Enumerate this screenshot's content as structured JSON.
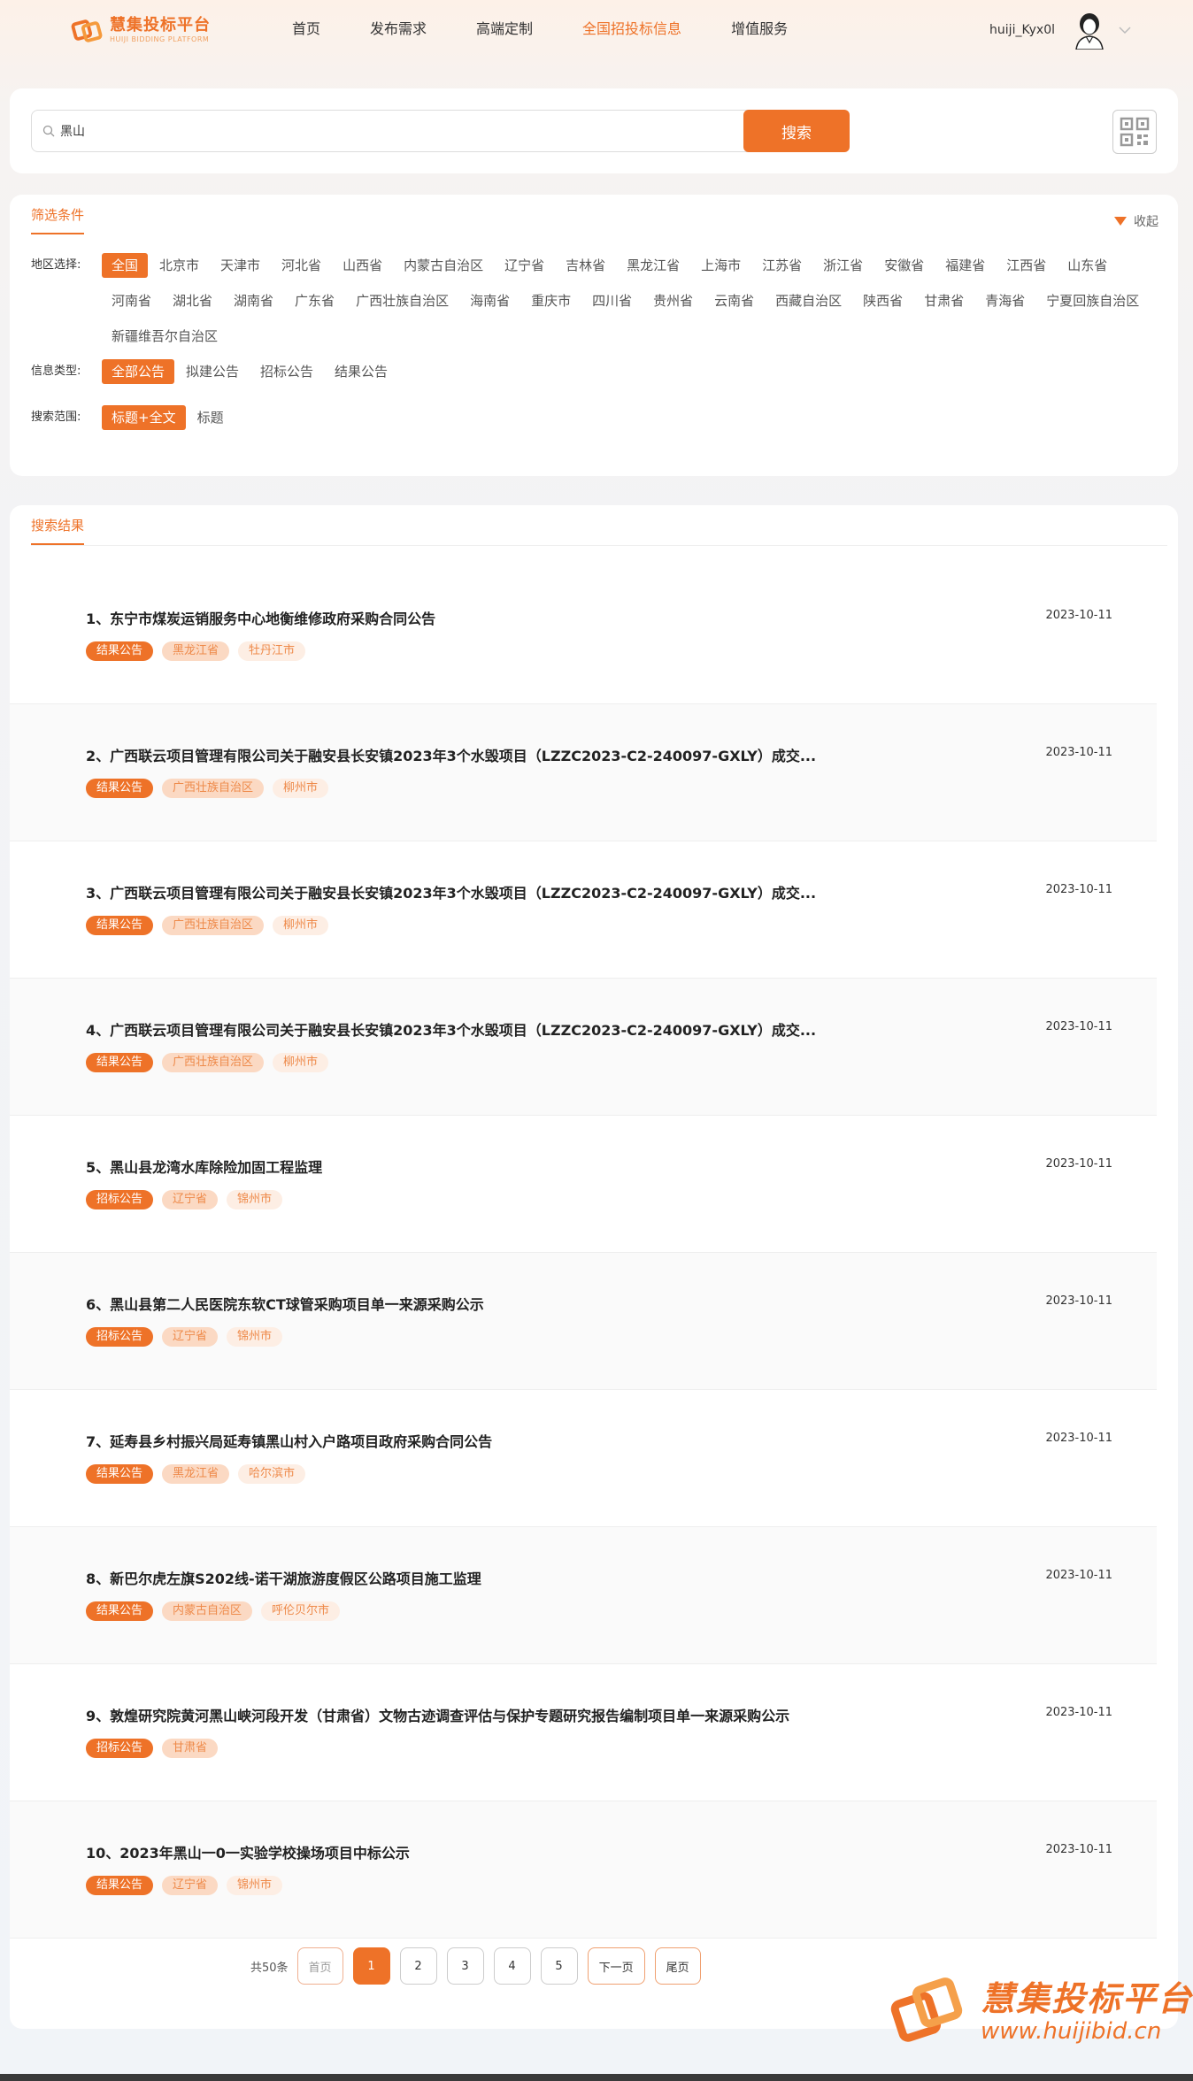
{
  "brand": {
    "name_cn": "慧集投标平台",
    "name_en": "HUIJI BIDDING PLATFORM"
  },
  "nav": [
    {
      "label": "首页",
      "active": false
    },
    {
      "label": "发布需求",
      "active": false
    },
    {
      "label": "高端定制",
      "active": false
    },
    {
      "label": "全国招投标信息",
      "active": true
    },
    {
      "label": "增值服务",
      "active": false
    }
  ],
  "user": {
    "name": "huiji_Kyx0l"
  },
  "search": {
    "value": "黑山",
    "button": "搜索"
  },
  "filters": {
    "title": "筛选条件",
    "collapse": "收起",
    "region": {
      "label": "地区选择:",
      "options": [
        "全国",
        "北京市",
        "天津市",
        "河北省",
        "山西省",
        "内蒙古自治区",
        "辽宁省",
        "吉林省",
        "黑龙江省",
        "上海市",
        "江苏省",
        "浙江省",
        "安徽省",
        "福建省",
        "江西省",
        "山东省",
        "河南省",
        "湖北省",
        "湖南省",
        "广东省",
        "广西壮族自治区",
        "海南省",
        "重庆市",
        "四川省",
        "贵州省",
        "云南省",
        "西藏自治区",
        "陕西省",
        "甘肃省",
        "青海省",
        "宁夏回族自治区",
        "新疆维吾尔自治区"
      ],
      "selected": "全国"
    },
    "info_type": {
      "label": "信息类型:",
      "options": [
        "全部公告",
        "拟建公告",
        "招标公告",
        "结果公告"
      ],
      "selected": "全部公告"
    },
    "scope": {
      "label": "搜索范围:",
      "options": [
        "标题+全文",
        "标题"
      ],
      "selected": "标题+全文"
    }
  },
  "results": {
    "title": "搜索结果",
    "items": [
      {
        "title": "1、东宁市煤炭运销服务中心地衡维修政府采购合同公告",
        "date": "2023-10-11",
        "type": "结果公告",
        "province": "黑龙江省",
        "city": "牡丹江市"
      },
      {
        "title": "2、广西联云项目管理有限公司关于融安县长安镇2023年3个水毁项目（LZZC2023-C2-240097-GXLY）成交...",
        "date": "2023-10-11",
        "type": "结果公告",
        "province": "广西壮族自治区",
        "city": "柳州市"
      },
      {
        "title": "3、广西联云项目管理有限公司关于融安县长安镇2023年3个水毁项目（LZZC2023-C2-240097-GXLY）成交...",
        "date": "2023-10-11",
        "type": "结果公告",
        "province": "广西壮族自治区",
        "city": "柳州市"
      },
      {
        "title": "4、广西联云项目管理有限公司关于融安县长安镇2023年3个水毁项目（LZZC2023-C2-240097-GXLY）成交...",
        "date": "2023-10-11",
        "type": "结果公告",
        "province": "广西壮族自治区",
        "city": "柳州市"
      },
      {
        "title": "5、黑山县龙湾水库除险加固工程监理",
        "date": "2023-10-11",
        "type": "招标公告",
        "province": "辽宁省",
        "city": "锦州市"
      },
      {
        "title": "6、黑山县第二人民医院东软CT球管采购项目单一来源采购公示",
        "date": "2023-10-11",
        "type": "招标公告",
        "province": "辽宁省",
        "city": "锦州市"
      },
      {
        "title": "7、延寿县乡村振兴局延寿镇黑山村入户路项目政府采购合同公告",
        "date": "2023-10-11",
        "type": "结果公告",
        "province": "黑龙江省",
        "city": "哈尔滨市"
      },
      {
        "title": "8、新巴尔虎左旗S202线-诺干湖旅游度假区公路项目施工监理",
        "date": "2023-10-11",
        "type": "结果公告",
        "province": "内蒙古自治区",
        "city": "呼伦贝尔市"
      },
      {
        "title": "9、敦煌研究院黄河黑山峡河段开发（甘肃省）文物古迹调查评估与保护专题研究报告编制项目单一来源采购公示",
        "date": "2023-10-11",
        "type": "招标公告",
        "province": "甘肃省",
        "city": ""
      },
      {
        "title": "10、2023年黑山一0一实验学校操场项目中标公示",
        "date": "2023-10-11",
        "type": "结果公告",
        "province": "辽宁省",
        "city": "锦州市"
      }
    ]
  },
  "pagination": {
    "total": "共50条",
    "first": "首页",
    "pages": [
      "1",
      "2",
      "3",
      "4",
      "5"
    ],
    "current": "1",
    "next": "下一页",
    "last": "尾页"
  },
  "watermark": {
    "name_cn": "慧集投标平台",
    "url": "www.huijibid.cn"
  },
  "colors": {
    "accent": "#ee7228"
  }
}
